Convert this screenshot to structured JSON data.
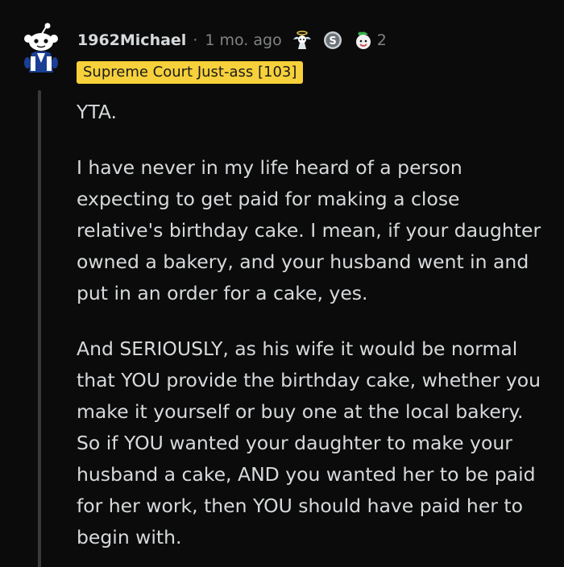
{
  "comment": {
    "username": "1962Michael",
    "separator": "·",
    "time": "1 mo. ago",
    "awards": [
      {
        "icon": "angel-award-icon"
      },
      {
        "icon": "silver-s-award-icon"
      },
      {
        "icon": "wholesome-award-icon"
      }
    ],
    "award_count": "2",
    "flair": "Supreme Court Just-ass [103]",
    "paragraphs": [
      "YTA.",
      "I have never in my life heard of a person expecting to get paid for making a close relative's birthday cake. I mean, if your daughter owned a bakery, and your husband went in and put in an order for a cake, yes.",
      "And SERIOUSLY, as his wife it would be normal that YOU provide the birthday cake, whether you make it yourself or buy one at the local bakery. So if YOU wanted your daughter to make your husband a cake, AND you wanted her to be paid for her work, then YOU should have paid her to begin with."
    ]
  },
  "colors": {
    "background": "#0b0b0b",
    "text": "#d7dadc",
    "meta": "#818384",
    "flair_bg": "#f7d13b",
    "thread_line": "#3a3a3a"
  }
}
